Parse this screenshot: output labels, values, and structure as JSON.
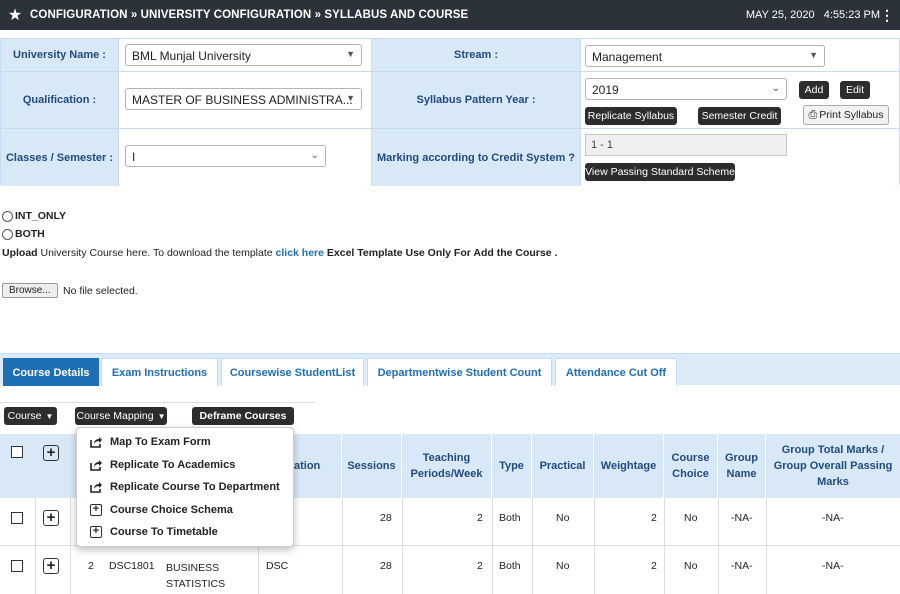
{
  "header": {
    "breadcrumb": "CONFIGURATION » UNIVERSITY CONFIGURATION » SYLLABUS AND COURSE",
    "date": "MAY 25, 2020",
    "time": "4:55:23 PM"
  },
  "form": {
    "university_label": "University Name :",
    "university_value": "BML Munjal University",
    "stream_label": "Stream :",
    "stream_value": "Management",
    "qualification_label": "Qualification :",
    "qualification_value": "MASTER OF BUSINESS ADMINISTRA...",
    "pattern_label": "Syllabus Pattern Year :",
    "pattern_value": "2019",
    "add_label": "Add",
    "edit_label": "Edit",
    "replicate_label": "Replicate Syllabus",
    "semester_credit_label": "Semester Credit",
    "print_label": "Print Syllabus",
    "classes_label": "Classes / Semester :",
    "classes_value": "I",
    "marking_label": "Marking according to Credit System ?",
    "marking_value": "1 - 1",
    "passing_label": "View Passing Standard Scheme"
  },
  "options": {
    "int_only": "INT_ONLY",
    "both": "BOTH"
  },
  "upload": {
    "prefix_bold": "Upload",
    "text": " University Course here. To download the template ",
    "link": "click here",
    "suffix_bold": " Excel Template Use Only For Add the Course .",
    "browse_label": "Browse...",
    "file_status": "No file selected."
  },
  "tabs": [
    {
      "label": "Course Details"
    },
    {
      "label": "Exam Instructions"
    },
    {
      "label": "Coursewise StudentList"
    },
    {
      "label": "Departmentwise Student Count"
    },
    {
      "label": "Attendance Cut Off"
    }
  ],
  "toolbar": {
    "course": "Course",
    "course_mapping": "Course Mapping",
    "deframe": "Deframe Courses"
  },
  "menu": [
    {
      "label": "Map To Exam Form",
      "icon": "share-icon"
    },
    {
      "label": "Replicate To Academics",
      "icon": "share-icon"
    },
    {
      "label": "Replicate Course To Department",
      "icon": "share-icon"
    },
    {
      "label": "Course Choice Schema",
      "icon": "plus-square-icon"
    },
    {
      "label": "Course To Timetable",
      "icon": "plus-square-icon"
    }
  ],
  "table": {
    "headers": {
      "abbreviation": "eviation",
      "sessions": "Sessions",
      "teaching": "Teaching\nPeriods/Week",
      "type": "Type",
      "practical": "Practical",
      "weightage": "Weightage",
      "choice": "Course\nChoice",
      "group": "Group\nName",
      "total": "Group Total Marks /\nGroup Overall Passing\nMarks"
    },
    "rows": [
      {
        "sr": "",
        "code": "",
        "name": "",
        "abbr": "",
        "sessions": "28",
        "teaching": "2",
        "type": "Both",
        "practical": "No",
        "weightage": "2",
        "choice": "No",
        "group": "-NA-",
        "total": "-NA-"
      },
      {
        "sr": "2",
        "code": "DSC1801",
        "name": "BUSINESS\nSTATISTICS",
        "abbr": "DSC",
        "sessions": "28",
        "teaching": "2",
        "type": "Both",
        "practical": "No",
        "weightage": "2",
        "choice": "No",
        "group": "-NA-",
        "total": "-NA-"
      }
    ]
  }
}
